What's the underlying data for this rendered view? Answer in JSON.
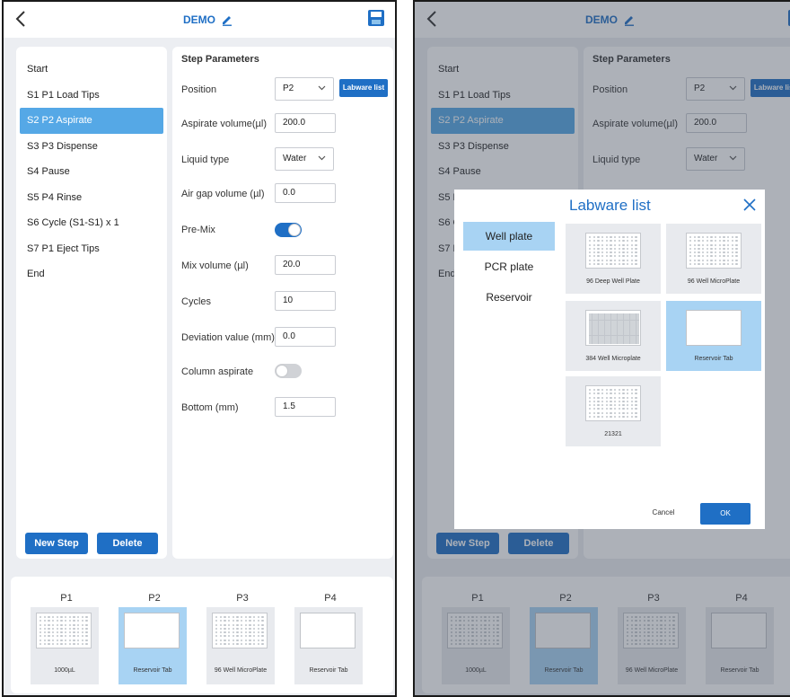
{
  "header": {
    "title": "DEMO"
  },
  "steps": [
    {
      "label": "Start"
    },
    {
      "label": "S1 P1 Load Tips"
    },
    {
      "label": "S2 P2 Aspirate"
    },
    {
      "label": "S3 P3 Dispense"
    },
    {
      "label": "S4  Pause"
    },
    {
      "label": "S5 P4 Rinse"
    },
    {
      "label": "S6  Cycle (S1-S1) x 1"
    },
    {
      "label": "S7 P1 Eject Tips"
    },
    {
      "label": "End"
    }
  ],
  "selected_step": 2,
  "buttons": {
    "new_step": "New Step",
    "delete": "Delete"
  },
  "params": {
    "heading": "Step Parameters",
    "position_label": "Position",
    "position_value": "P2",
    "labware_button": "Labware list",
    "aspirate_label": "Aspirate volume(µl)",
    "aspirate_value": "200.0",
    "liquid_label": "Liquid type",
    "liquid_value": "Water",
    "airgap_label": "Air gap volume (µl)",
    "airgap_value": "0.0",
    "premix_label": "Pre-Mix",
    "premix_on": true,
    "mix_label": "Mix volume (µl)",
    "mix_value": "20.0",
    "cycles_label": "Cycles",
    "cycles_value": "10",
    "deviation_label": "Deviation value (mm)",
    "deviation_value": "0.0",
    "column_label": "Column aspirate",
    "column_on": false,
    "bottom_label": "Bottom (mm)",
    "bottom_value": "1.5"
  },
  "positions": [
    {
      "name": "P1",
      "labware": "1000µL",
      "kind": "tips",
      "selected": false
    },
    {
      "name": "P2",
      "labware": "Reservoir Tab",
      "kind": "reservoir",
      "selected": true
    },
    {
      "name": "P3",
      "labware": "96 Well MicroPlate",
      "kind": "plate",
      "selected": false
    },
    {
      "name": "P4",
      "labware": "Reservoir Tab",
      "kind": "reservoir",
      "selected": false
    }
  ],
  "dialog": {
    "title": "Labware list",
    "categories": [
      "Well plate",
      "PCR plate",
      "Reservoir"
    ],
    "selected_category": 0,
    "items": [
      {
        "label": "96 Deep Well Plate",
        "kind": "plate",
        "selected": false
      },
      {
        "label": "96 Well MicroPlate",
        "kind": "plate",
        "selected": false
      },
      {
        "label": "384 Well Microplate",
        "kind": "plate384",
        "selected": false
      },
      {
        "label": "Reservoir Tab",
        "kind": "reservoir",
        "selected": true
      },
      {
        "label": "21321",
        "kind": "plate",
        "selected": false
      }
    ],
    "cancel": "Cancel",
    "ok": "OK"
  },
  "colors": {
    "accent": "#1f6fc5",
    "selection": "#55a8e6",
    "card_selected": "#a8d3f3"
  }
}
